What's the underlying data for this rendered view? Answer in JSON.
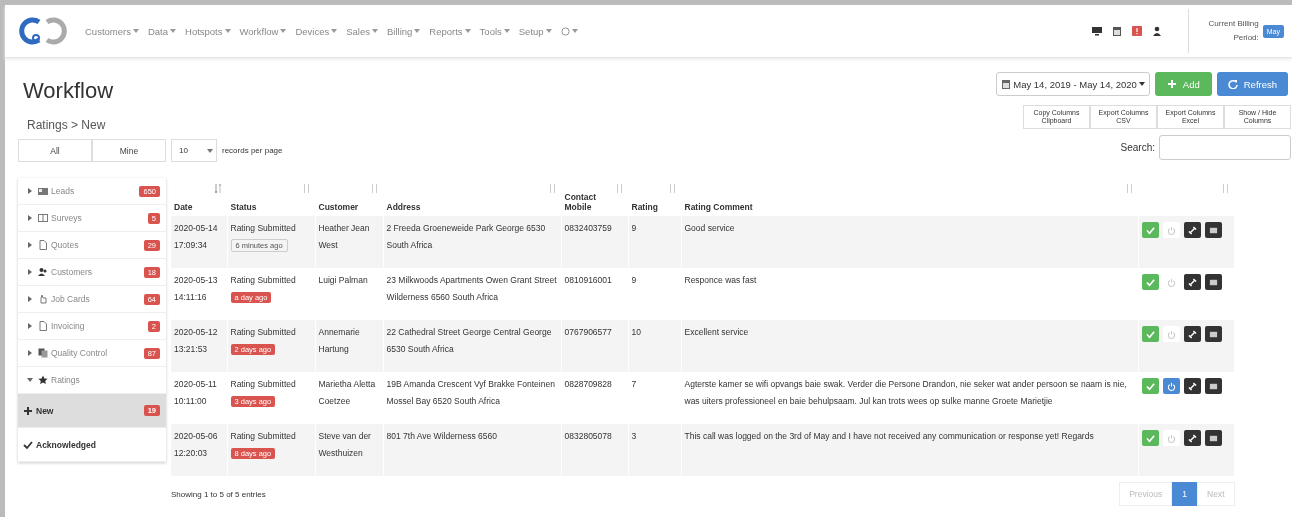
{
  "navbar": {
    "menu": [
      {
        "label": "Customers"
      },
      {
        "label": "Data"
      },
      {
        "label": "Hotspots"
      },
      {
        "label": "Workflow"
      },
      {
        "label": "Devices"
      },
      {
        "label": "Sales"
      },
      {
        "label": "Billing"
      },
      {
        "label": "Reports"
      },
      {
        "label": "Tools"
      },
      {
        "label": "Setup"
      },
      {
        "kind": "help"
      }
    ],
    "billing_label": "Current Billing Period:",
    "billing_period": "May"
  },
  "page": {
    "title": "Workflow",
    "breadcrumb": "Ratings > New"
  },
  "toolbar": {
    "date_range": "May 14, 2019 - May 14, 2020",
    "add": "Add",
    "refresh": "Refresh"
  },
  "filter": [
    {
      "label": "All",
      "selected": false
    },
    {
      "label": "Mine",
      "selected": false
    }
  ],
  "page_size": {
    "value": "10",
    "label": "records per page"
  },
  "export_buttons": [
    "Copy Columns Clipboard",
    "Export Columns CSV",
    "Export Columns Excel",
    "Show / Hide Columns"
  ],
  "search": {
    "label": "Search:"
  },
  "sidebar": {
    "items": [
      {
        "label": "Leads",
        "badge": "650",
        "expanded": false,
        "selected": false
      },
      {
        "label": "Surveys",
        "badge": "5",
        "expanded": false,
        "selected": false
      },
      {
        "label": "Quotes",
        "badge": "29",
        "expanded": false,
        "selected": false
      },
      {
        "label": "Customers",
        "badge": "18",
        "expanded": false,
        "selected": false
      },
      {
        "label": "Job Cards",
        "badge": "64",
        "expanded": false,
        "selected": false
      },
      {
        "label": "Invoicing",
        "badge": "2",
        "expanded": false,
        "selected": false
      },
      {
        "label": "Quality Control",
        "badge": "87",
        "expanded": false,
        "selected": false
      },
      {
        "label": "Ratings",
        "expanded": true,
        "selected": false,
        "children": [
          {
            "label": "New",
            "badge": "19",
            "selected": true
          },
          {
            "label": "Acknowledged",
            "selected": false
          }
        ]
      }
    ]
  },
  "table": {
    "columns": [
      "Date",
      "Status",
      "Customer",
      "Address",
      "Contact Mobile",
      "Rating",
      "Rating Comment"
    ],
    "rows": [
      {
        "date": "2020-05-14 17:09:34",
        "status": "Rating Submitted",
        "age": "6 minutes ago",
        "overdue": false,
        "customer": "Heather Jean West",
        "address": "2 Freeda Groeneweide Park George 6530 South Africa",
        "mobile": "0832403759",
        "rating": "9",
        "comment": "Good service",
        "assigned": false
      },
      {
        "date": "2020-05-13 14:11:16",
        "status": "Rating Submitted",
        "age": "a day ago",
        "overdue": true,
        "customer": "Luigi Palman",
        "address": "23 Milkwoods Apartments Owen Grant Street Wilderness 6560 South Africa",
        "mobile": "0810916001",
        "rating": "9",
        "comment": "Responce was fast",
        "assigned": false
      },
      {
        "date": "2020-05-12 13:21:53",
        "status": "Rating Submitted",
        "age": "2 days ago",
        "overdue": true,
        "customer": "Annemarie Hartung",
        "address": "22 Cathedral Street George Central George 6530 South Africa",
        "mobile": "0767906577",
        "rating": "10",
        "comment": "Excellent service",
        "assigned": false
      },
      {
        "date": "2020-05-11 10:11:00",
        "status": "Rating Submitted",
        "age": "3 days ago",
        "overdue": true,
        "customer": "Marietha Aletta Coetzee",
        "address": "19B Amanda Crescent Vyf Brakke Fonteinen Mossel Bay 6520 South Africa",
        "mobile": "0828709828",
        "rating": "7",
        "comment": "Agterste kamer se wifi opvangs baie swak. Verder die Persone Drandon, nie seker wat ander persoon se naam is nie, was uiters professioneel en baie behulpsaam. Jul kan trots wees op sulke manne Groete Marietjie",
        "assigned": true
      },
      {
        "date": "2020-05-06 12:20:03",
        "status": "Rating Submitted",
        "age": "8 days ago",
        "overdue": true,
        "customer": "Steve van der Westhuizen",
        "address": "801 7th Ave Wilderness 6560",
        "mobile": "0832805078",
        "rating": "3",
        "comment": "This call was logged on the 3rd of May and I have not received any communication or response yet! Regards",
        "assigned": false
      }
    ],
    "info": "Showing 1 to 5 of 5 entries"
  },
  "pagination": [
    {
      "label": "Previous",
      "disabled": true
    },
    {
      "label": "1",
      "selected": true
    },
    {
      "label": "Next",
      "disabled": true
    }
  ]
}
